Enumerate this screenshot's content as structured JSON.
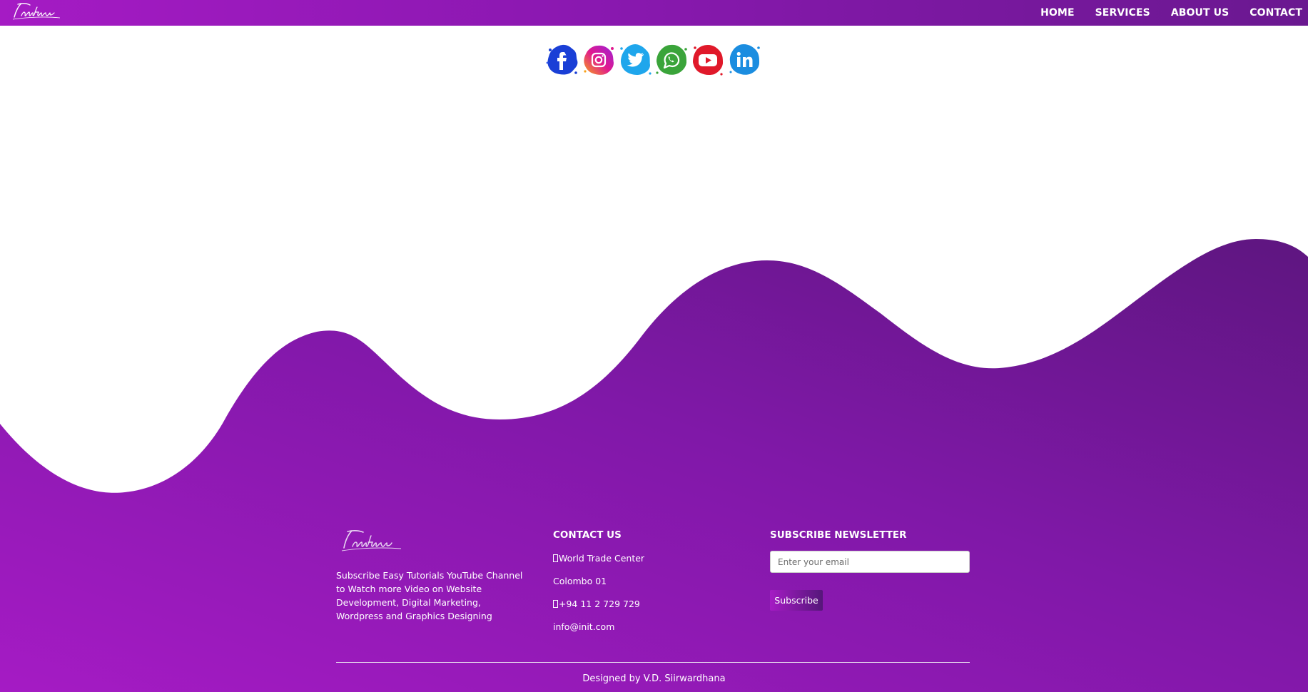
{
  "brand": {
    "logo_text": "Initiative"
  },
  "nav": {
    "items": [
      {
        "label": "HOME"
      },
      {
        "label": "SERVICES"
      },
      {
        "label": "ABOUT US"
      },
      {
        "label": "CONTACT"
      }
    ]
  },
  "social": {
    "icons": [
      {
        "name": "facebook-icon",
        "color": "#1a3fd6"
      },
      {
        "name": "instagram-icon",
        "color": "#e018b8"
      },
      {
        "name": "twitter-icon",
        "color": "#1fa6ec"
      },
      {
        "name": "whatsapp-icon",
        "color": "#3aa43a"
      },
      {
        "name": "youtube-icon",
        "color": "#e0192a"
      },
      {
        "name": "linkedin-icon",
        "color": "#1b8de0"
      }
    ]
  },
  "footer": {
    "about_text": "Subscribe Easy Tutorials YouTube Channel to Watch more Video on Website Development, Digital Marketing, Wordpress and Graphics Designing",
    "contact": {
      "title": "CONTACT US",
      "address_line1": "World Trade Center",
      "address_line2": "Colombo 01",
      "phone": "+94 11 2 729 729",
      "email": "info@init.com"
    },
    "newsletter": {
      "title": "SUBSCRIBE NEWSLETTER",
      "placeholder": "Enter your email",
      "button_label": "Subscribe"
    },
    "credit": "Designed by V.D. Siirwardhana"
  },
  "colors": {
    "gradient_start": "#a51bc4",
    "gradient_end": "#5e1680"
  }
}
